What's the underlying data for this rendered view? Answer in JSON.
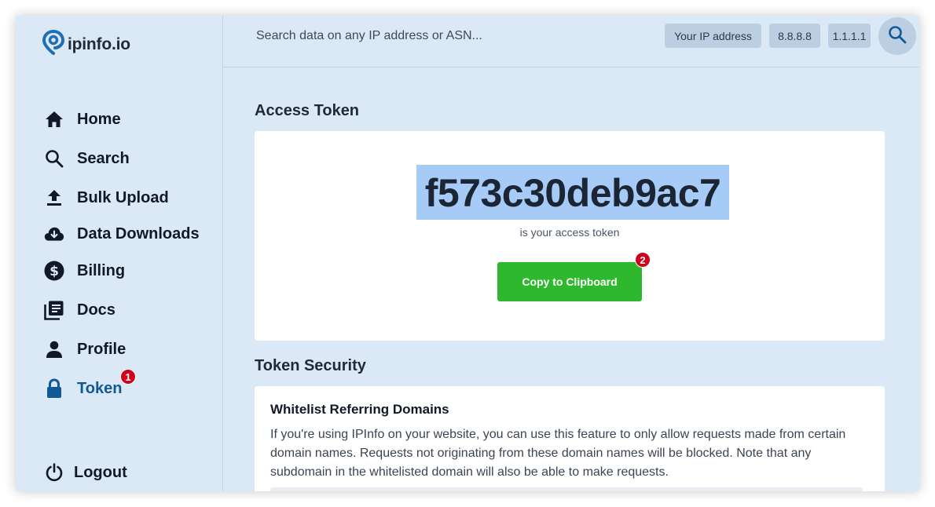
{
  "app": {
    "logo_text": "ipinfo.io"
  },
  "sidebar": {
    "items": [
      {
        "label": "Home",
        "icon": "home-icon"
      },
      {
        "label": "Search",
        "icon": "search-icon"
      },
      {
        "label": "Bulk Upload",
        "icon": "upload-icon"
      },
      {
        "label": "Data Downloads",
        "icon": "cloud-download-icon"
      },
      {
        "label": "Billing",
        "icon": "dollar-icon"
      },
      {
        "label": "Docs",
        "icon": "docs-icon"
      },
      {
        "label": "Profile",
        "icon": "person-icon"
      },
      {
        "label": "Token",
        "icon": "lock-icon",
        "active": true,
        "badge": "1"
      }
    ],
    "logout_label": "Logout"
  },
  "topbar": {
    "search_placeholder": "Search data on any IP address or ASN...",
    "chips": [
      "Your IP address",
      "8.8.8.8",
      "1.1.1.1"
    ]
  },
  "main": {
    "access_title": "Access Token",
    "token": "f573c30deb9ac7",
    "token_sub": "is your access token",
    "copy_label": "Copy to Clipboard",
    "copy_badge": "2",
    "security_title": "Token Security",
    "whitelist": {
      "heading": "Whitelist Referring Domains",
      "body": "If you're using IPInfo on your website, you can use this feature to only allow requests made from certain domain names. Requests not originating from these domain names will be blocked. Note that any subdomain in the whitelisted domain will also be able to make requests."
    }
  },
  "colors": {
    "accent": "#0f5a96",
    "sidebar_bg": "#dbe8f5",
    "copy_button": "#2eb82e",
    "badge": "#d0021b",
    "token_highlight": "#a7cbf7"
  }
}
